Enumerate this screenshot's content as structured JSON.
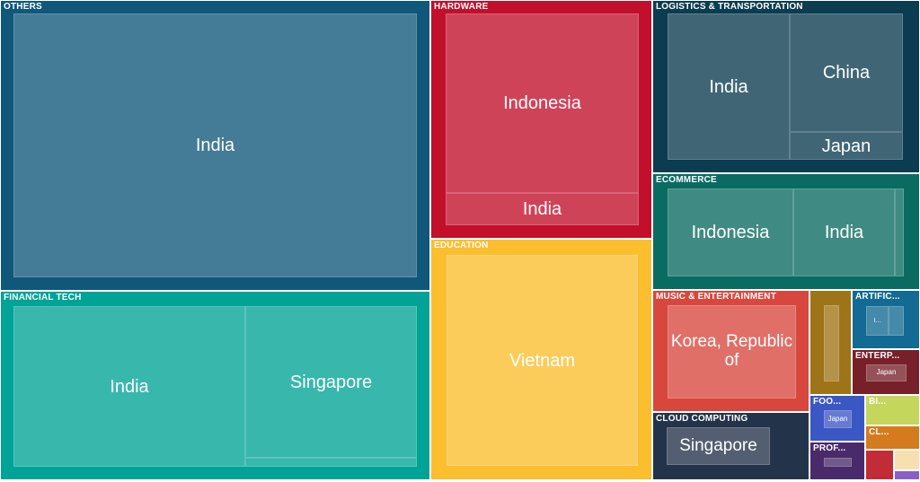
{
  "groups": [
    {
      "key": "others",
      "title": "OTHERS",
      "color": "#10577a",
      "leaves": [
        {
          "key": "india",
          "label": "India"
        }
      ]
    },
    {
      "key": "hardware",
      "title": "HARDWARE",
      "color": "#c20f2b",
      "leaves": [
        {
          "key": "indonesia",
          "label": "Indonesia"
        },
        {
          "key": "india",
          "label": "India"
        }
      ]
    },
    {
      "key": "logistics",
      "title": "LOGISTICS & TRANSPORTATION",
      "color": "#0b3c50",
      "leaves": [
        {
          "key": "india",
          "label": "India"
        },
        {
          "key": "china",
          "label": "China"
        },
        {
          "key": "japan",
          "label": "Japan"
        }
      ]
    },
    {
      "key": "ecommerce",
      "title": "ECOMMERCE",
      "color": "#0a6b61",
      "leaves": [
        {
          "key": "indonesia",
          "label": "Indonesia"
        },
        {
          "key": "india",
          "label": "India"
        },
        {
          "key": "other",
          "label": ""
        }
      ]
    },
    {
      "key": "fintech",
      "title": "FINANCIAL TECH",
      "color": "#00a396",
      "leaves": [
        {
          "key": "india",
          "label": "India"
        },
        {
          "key": "singapore",
          "label": "Singapore"
        },
        {
          "key": "other",
          "label": ""
        }
      ]
    },
    {
      "key": "education",
      "title": "EDUCATION",
      "color": "#fbbe2e",
      "leaves": [
        {
          "key": "vietnam",
          "label": "Vietnam"
        }
      ]
    },
    {
      "key": "music",
      "title": "MUSIC & ENTERTAINMENT",
      "color": "#d8473d",
      "leaves": [
        {
          "key": "korea",
          "label": "Korea, Republic of"
        }
      ]
    },
    {
      "key": "unlabeled-gold",
      "title": "",
      "color": "#9e7418",
      "leaves": [
        {
          "key": "a",
          "label": ""
        }
      ]
    },
    {
      "key": "ai",
      "title": "ARTIFIC...",
      "color": "#136a92",
      "leaves": [
        {
          "key": "a",
          "label": "I..."
        },
        {
          "key": "b",
          "label": ""
        }
      ]
    },
    {
      "key": "enterprise",
      "title": "ENTERP...",
      "color": "#782029",
      "leaves": [
        {
          "key": "japan",
          "label": "Japan"
        }
      ]
    },
    {
      "key": "cloud",
      "title": "CLOUD COMPUTING",
      "color": "#23334a",
      "leaves": [
        {
          "key": "singapore",
          "label": "Singapore"
        }
      ]
    },
    {
      "key": "food",
      "title": "FOO...",
      "color": "#3b57c4",
      "leaves": [
        {
          "key": "japan",
          "label": "Japan"
        }
      ]
    },
    {
      "key": "bi",
      "title": "BI...",
      "color": "#c4d65b",
      "leaves": []
    },
    {
      "key": "cl",
      "title": "CL...",
      "color": "#d47b1e",
      "leaves": []
    },
    {
      "key": "prof",
      "title": "PROF...",
      "color": "#4b2a6b",
      "leaves": [
        {
          "key": "a",
          "label": ""
        }
      ]
    },
    {
      "key": "red-small",
      "title": "",
      "color": "#c22c36",
      "leaves": []
    },
    {
      "key": "cream-small",
      "title": "",
      "color": "#f7dfb0",
      "leaves": []
    },
    {
      "key": "purple-small",
      "title": "",
      "color": "#8a5fc7",
      "leaves": []
    }
  ],
  "chart_data": {
    "type": "treemap",
    "title": "",
    "series": [
      {
        "group": "OTHERS",
        "items": [
          {
            "name": "India"
          }
        ]
      },
      {
        "group": "HARDWARE",
        "items": [
          {
            "name": "Indonesia"
          },
          {
            "name": "India"
          }
        ]
      },
      {
        "group": "LOGISTICS & TRANSPORTATION",
        "items": [
          {
            "name": "India"
          },
          {
            "name": "China"
          },
          {
            "name": "Japan"
          }
        ]
      },
      {
        "group": "ECOMMERCE",
        "items": [
          {
            "name": "Indonesia"
          },
          {
            "name": "India"
          }
        ]
      },
      {
        "group": "FINANCIAL TECH",
        "items": [
          {
            "name": "India"
          },
          {
            "name": "Singapore"
          }
        ]
      },
      {
        "group": "EDUCATION",
        "items": [
          {
            "name": "Vietnam"
          }
        ]
      },
      {
        "group": "MUSIC & ENTERTAINMENT",
        "items": [
          {
            "name": "Korea, Republic of"
          }
        ]
      },
      {
        "group": "CLOUD COMPUTING",
        "items": [
          {
            "name": "Singapore"
          }
        ]
      },
      {
        "group": "ARTIFIC...",
        "items": [
          {
            "name": "I..."
          }
        ]
      },
      {
        "group": "ENTERP...",
        "items": [
          {
            "name": "Japan"
          }
        ]
      },
      {
        "group": "FOO...",
        "items": [
          {
            "name": "Japan"
          }
        ]
      },
      {
        "group": "BI...",
        "items": []
      },
      {
        "group": "CL...",
        "items": []
      },
      {
        "group": "PROF...",
        "items": []
      }
    ]
  }
}
